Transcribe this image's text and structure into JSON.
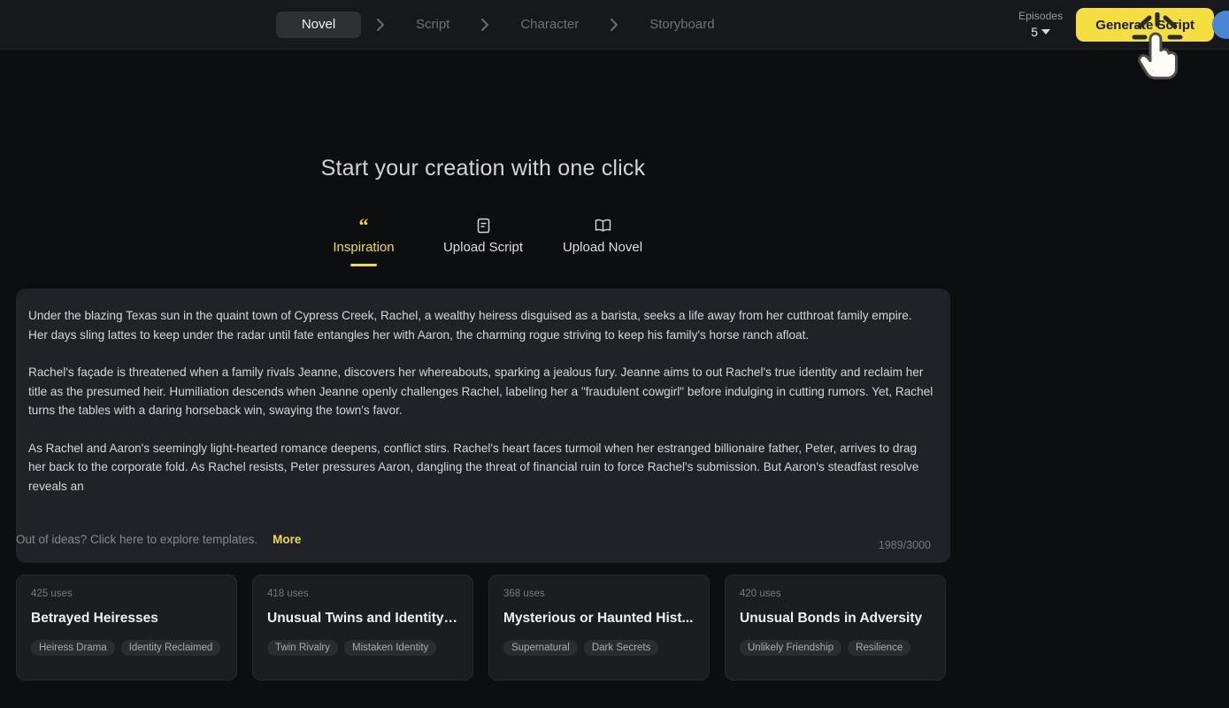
{
  "header": {
    "breadcrumb": [
      {
        "label": "Novel",
        "active": true
      },
      {
        "label": "Script",
        "active": false
      },
      {
        "label": "Character",
        "active": false
      },
      {
        "label": "Storyboard",
        "active": false
      }
    ],
    "episodes": {
      "label": "Episodes",
      "value": "5"
    },
    "generate_button": "Generate Script",
    "avatar": "user-avatar"
  },
  "main": {
    "title": "Start your creation with one click",
    "tabs": [
      {
        "label": "Inspiration",
        "icon": "quote-icon",
        "active": true
      },
      {
        "label": "Upload Script",
        "icon": "document-icon",
        "active": false
      },
      {
        "label": "Upload Novel",
        "icon": "book-icon",
        "active": false
      }
    ],
    "editor": {
      "paragraphs": [
        "Under the blazing Texas sun in the quaint town of Cypress Creek, Rachel, a wealthy heiress disguised as a barista, seeks a life away from her cutthroat family empire. Her days sling lattes to keep under the radar until fate entangles her with Aaron, the charming rogue striving to keep his family's horse ranch afloat.",
        "Rachel's façade is threatened when a family rivals Jeanne, discovers her whereabouts, sparking a jealous fury. Jeanne aims to out Rachel's true identity and reclaim her title as the presumed heir. Humiliation descends when Jeanne openly challenges Rachel, labeling her a \"fraudulent cowgirl\" before indulging in cutting rumors. Yet, Rachel turns the tables with a daring horseback win, swaying the town's favor.",
        "As Rachel and Aaron's seemingly light-hearted romance deepens, conflict stirs. Rachel's heart faces turmoil when her estranged billionaire father, Peter, arrives to drag her back to the corporate fold. As Rachel resists, Peter pressures Aaron, dangling the threat of financial ruin to force Rachel's submission. But Aaron's steadfast resolve reveals an"
      ],
      "char_count": "1989/3000"
    },
    "templates_hint": "Out of ideas? Click here to explore templates.",
    "more_label": "More",
    "cards": [
      {
        "uses": "425 uses",
        "title": "Betrayed Heiresses",
        "tags": [
          "Heiress Drama",
          "Identity Reclaimed"
        ]
      },
      {
        "uses": "418 uses",
        "title": "Unusual Twins and Identity ...",
        "tags": [
          "Twin Rivalry",
          "Mistaken Identity"
        ]
      },
      {
        "uses": "368 uses",
        "title": "Mysterious or Haunted Hist...",
        "tags": [
          "Supernatural",
          "Dark Secrets"
        ]
      },
      {
        "uses": "420 uses",
        "title": "Unusual Bonds in Adversity",
        "tags": [
          "Unlikely Friendship",
          "Resilience"
        ]
      }
    ]
  },
  "colors": {
    "accent_yellow": "#f5de3f",
    "background": "#0d0e10",
    "header_bg": "#17181c",
    "panel_bg": "#212227",
    "card_bg": "#1c1d21",
    "avatar_blue": "#4a86d4"
  }
}
